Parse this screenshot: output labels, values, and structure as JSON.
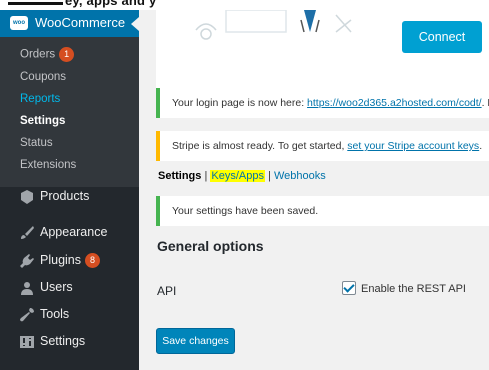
{
  "top_strip": {
    "text": "ey, apps and you like a bit more o"
  },
  "sidebar": {
    "header": {
      "logo_text": "woo",
      "title": "WooCommerce"
    },
    "submenu": [
      {
        "label": "Orders",
        "badge": "1"
      },
      {
        "label": "Coupons"
      },
      {
        "label": "Reports"
      },
      {
        "label": "Settings"
      },
      {
        "label": "Status"
      },
      {
        "label": "Extensions"
      }
    ],
    "menu": [
      {
        "label": "Products",
        "icon": "products-icon"
      },
      {
        "label": "Appearance",
        "icon": "paintbrush-icon"
      },
      {
        "label": "Plugins",
        "icon": "plugin-icon",
        "badge": "8"
      },
      {
        "label": "Users",
        "icon": "users-icon"
      },
      {
        "label": "Tools",
        "icon": "wrench-icon"
      },
      {
        "label": "Settings",
        "icon": "settings-icon"
      }
    ]
  },
  "connect": {
    "button_label": "Connect"
  },
  "notices": {
    "login": {
      "text": "Your login page is now here: ",
      "link": "https://woo2d365.a2hosted.com/codt/",
      "tail": ". B"
    },
    "stripe": {
      "text": "Stripe is almost ready. To get started, ",
      "link": "set your Stripe account keys",
      "tail": "."
    },
    "saved": {
      "text": "Your settings have been saved."
    }
  },
  "subnav": {
    "settings": "Settings",
    "sep1": " | ",
    "keys": "Keys/Apps",
    "sep2": " | ",
    "webhooks": "Webhooks"
  },
  "general": {
    "title": "General options",
    "api_label": "API",
    "api_checkbox_label": "Enable the REST API",
    "api_checked": true
  },
  "save_button": "Save changes",
  "colors": {
    "accent": "#0073aa",
    "sidebar": "#23282d",
    "wc_blue": "#0073aa",
    "success": "#46b450",
    "warning": "#ffb900",
    "highlight": "#ffff00"
  }
}
